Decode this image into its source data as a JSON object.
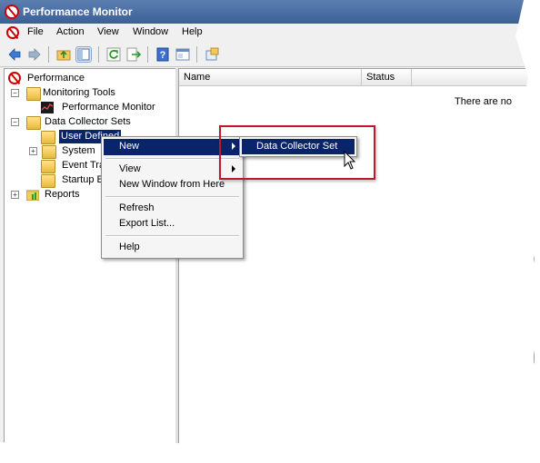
{
  "window": {
    "title": "Performance Monitor"
  },
  "menubar": [
    "File",
    "Action",
    "View",
    "Window",
    "Help"
  ],
  "toolbar": {
    "icons": [
      "back-icon",
      "forward-icon",
      "up-folder-icon",
      "show-hide-tree-icon",
      "refresh-icon",
      "export-list-icon",
      "help-icon",
      "properties-icon",
      "new-window-icon"
    ]
  },
  "tree": {
    "root": "Performance",
    "monitoring_tools": "Monitoring Tools",
    "performance_monitor": "Performance Monitor",
    "data_collector_sets": "Data Collector Sets",
    "user_defined": "User Defined",
    "system": "System",
    "event_trace": "Event Tra",
    "startup": "Startup E",
    "reports": "Reports"
  },
  "list": {
    "columns": [
      "Name",
      "Status"
    ],
    "empty_message": "There are no"
  },
  "context_menu": {
    "items": [
      "New",
      "View",
      "New Window from Here",
      "Refresh",
      "Export List...",
      "Help"
    ]
  },
  "submenu": {
    "items": [
      "Data Collector Set"
    ]
  },
  "colors": {
    "selection": "#0a246a",
    "highlight_box": "#c0182a",
    "titlebar": "#4a6ea5"
  }
}
